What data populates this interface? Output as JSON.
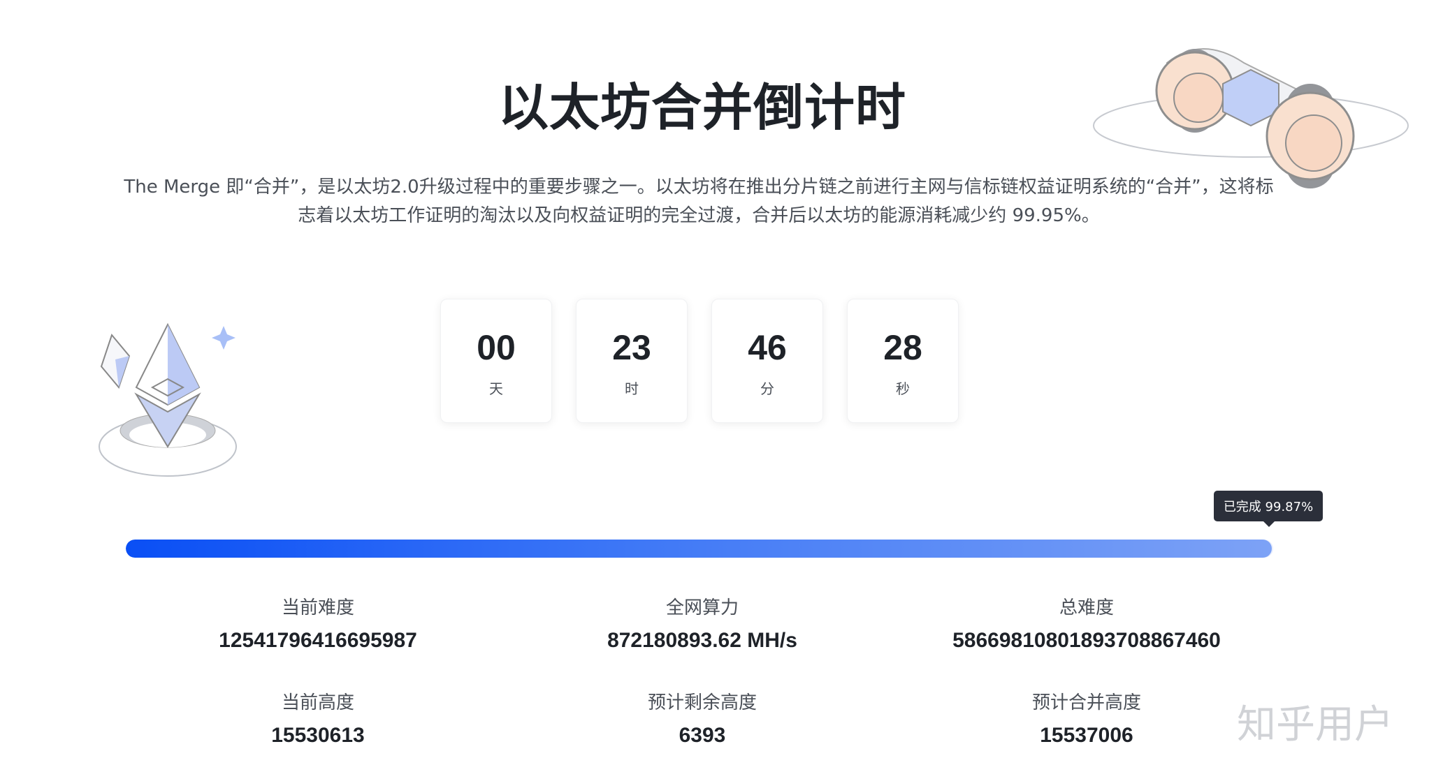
{
  "header": {
    "title": "以太坊合并倒计时",
    "description": "The Merge 即“合并”，是以太坊2.0升级过程中的重要步骤之一。以太坊将在推出分片链之前进行主网与信标链权益证明系统的“合并”，这将标志着以太坊工作证明的淘汰以及向权益证明的完全过渡，合并后以太坊的能源消耗减少约 99.95%。"
  },
  "countdown": [
    {
      "value": "00",
      "unit": "天"
    },
    {
      "value": "23",
      "unit": "时"
    },
    {
      "value": "46",
      "unit": "分"
    },
    {
      "value": "28",
      "unit": "秒"
    }
  ],
  "progress": {
    "label": "已完成 99.87%",
    "percent": 99.87
  },
  "stats": [
    {
      "label": "当前难度",
      "value": "12541796416695987"
    },
    {
      "label": "全网算力",
      "value": "872180893.62 MH/s"
    },
    {
      "label": "总难度",
      "value": "58669810801893708867460"
    },
    {
      "label": "当前高度",
      "value": "15530613"
    },
    {
      "label": "预计剩余高度",
      "value": "6393"
    },
    {
      "label": "预计合并高度",
      "value": "15537006"
    }
  ],
  "watermark": "知乎用户",
  "colors": {
    "progress_start": "#0a4ff5",
    "progress_end": "#7da2f6",
    "tooltip_bg": "#2b2f3a"
  },
  "icons": {
    "decoration_top_right": "merge-rollers-illustration",
    "decoration_left": "ethereum-crystal-illustration"
  }
}
